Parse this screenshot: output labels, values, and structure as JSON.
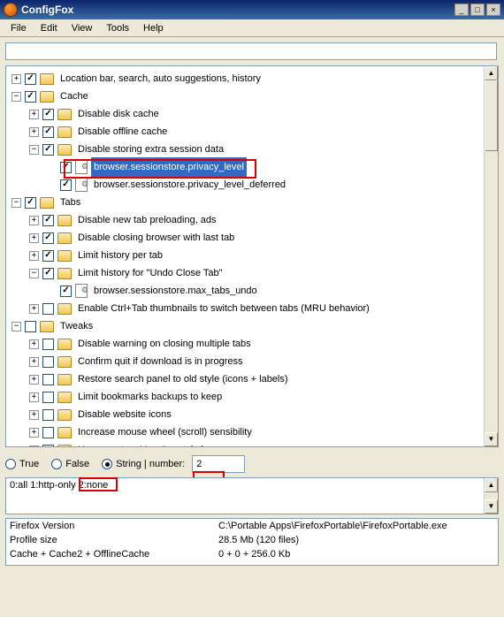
{
  "window": {
    "title": "ConfigFox"
  },
  "menu": {
    "file": "File",
    "edit": "Edit",
    "view": "View",
    "tools": "Tools",
    "help": "Help"
  },
  "search": {
    "value": ""
  },
  "tree": {
    "loc": "Location bar, search, auto suggestions, history",
    "cache": "Cache",
    "cache_disk": "Disable disk cache",
    "cache_offline": "Disable offline cache",
    "cache_extra": "Disable storing extra session data",
    "cache_priv": "browser.sessionstore.privacy_level",
    "cache_priv_def": "browser.sessionstore.privacy_level_deferred",
    "tabs": "Tabs",
    "tabs_preload": "Disable new tab preloading, ads",
    "tabs_close": "Disable closing browser with last tab",
    "tabs_limit": "Limit history per tab",
    "tabs_undo": "Limit history for \"Undo Close Tab\"",
    "tabs_undo_max": "browser.sessionstore.max_tabs_undo",
    "tabs_ctrltab": "Enable Ctrl+Tab thumbnails to switch between tabs (MRU behavior)",
    "tweaks": "Tweaks",
    "tw_warn": "Disable warning on closing multiple tabs",
    "tw_confirm": "Confirm quit if download is in progress",
    "tw_restore": "Restore search panel to old style (icons + labels)",
    "tw_bookmarks": "Limit bookmarks backups to keep",
    "tw_icons": "Disable website icons",
    "tw_mouse": "Increase mouse wheel (scroll) sensibility",
    "tw_ua": "Use a custom UserAgent String"
  },
  "radios": {
    "true": "True",
    "false": "False",
    "strnum": "String | number:"
  },
  "value_input": "2",
  "description": "0:all 1:http-only 2:none",
  "info": {
    "k1": "Firefox Version",
    "v1": "C:\\Portable Apps\\FirefoxPortable\\FirefoxPortable.exe",
    "k2": "Profile size",
    "v2": "28.5 Mb (120 files)",
    "k3": "Cache + Cache2 + OfflineCache",
    "v3": "0 + 0 + 256.0 Kb"
  },
  "scroll": {
    "up": "▲",
    "down": "▼"
  },
  "win": {
    "min": "_",
    "max": "□",
    "close": "×"
  }
}
